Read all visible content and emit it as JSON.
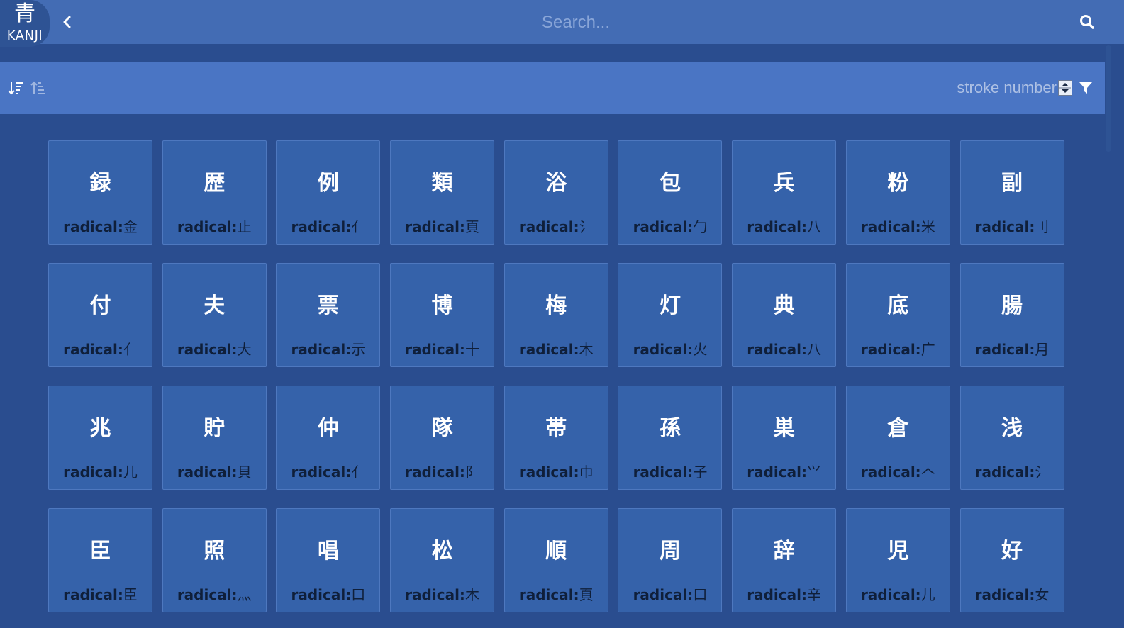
{
  "app": {
    "logo_kanji": "青",
    "logo_text": "KANJI",
    "back_icon": "chevron-left-icon",
    "search_placeholder": "Search...",
    "search_icon": "magnifier-icon"
  },
  "sort": {
    "desc_icon": "sort-descending-icon",
    "asc_icon": "sort-ascending-icon",
    "label": "stroke number",
    "stepper_icon": "up-down-stepper-icon",
    "filter_icon": "filter-icon"
  },
  "colors": {
    "topbar": "#436cb4",
    "sortbar": "#4a75c4",
    "background": "#2a4d8f",
    "card": "#3562aa"
  },
  "radical_label": "radical:",
  "cards": [
    {
      "kanji": "録",
      "radical": "金"
    },
    {
      "kanji": "歴",
      "radical": "止"
    },
    {
      "kanji": "例",
      "radical": "亻"
    },
    {
      "kanji": "類",
      "radical": "頁"
    },
    {
      "kanji": "浴",
      "radical": "氵"
    },
    {
      "kanji": "包",
      "radical": "勹"
    },
    {
      "kanji": "兵",
      "radical": "八"
    },
    {
      "kanji": "粉",
      "radical": "米"
    },
    {
      "kanji": "副",
      "radical": "刂"
    },
    {
      "kanji": "付",
      "radical": "亻"
    },
    {
      "kanji": "夫",
      "radical": "大"
    },
    {
      "kanji": "票",
      "radical": "示"
    },
    {
      "kanji": "博",
      "radical": "十"
    },
    {
      "kanji": "梅",
      "radical": "木"
    },
    {
      "kanji": "灯",
      "radical": "火"
    },
    {
      "kanji": "典",
      "radical": "八"
    },
    {
      "kanji": "底",
      "radical": "广"
    },
    {
      "kanji": "腸",
      "radical": "月"
    },
    {
      "kanji": "兆",
      "radical": "儿"
    },
    {
      "kanji": "貯",
      "radical": "貝"
    },
    {
      "kanji": "仲",
      "radical": "亻"
    },
    {
      "kanji": "隊",
      "radical": "阝"
    },
    {
      "kanji": "帯",
      "radical": "巾"
    },
    {
      "kanji": "孫",
      "radical": "子"
    },
    {
      "kanji": "巣",
      "radical": "⺍"
    },
    {
      "kanji": "倉",
      "radical": "𠆢"
    },
    {
      "kanji": "浅",
      "radical": "氵"
    },
    {
      "kanji": "臣",
      "radical": "臣"
    },
    {
      "kanji": "照",
      "radical": "灬"
    },
    {
      "kanji": "唱",
      "radical": "口"
    },
    {
      "kanji": "松",
      "radical": "木"
    },
    {
      "kanji": "順",
      "radical": "頁"
    },
    {
      "kanji": "周",
      "radical": "口"
    },
    {
      "kanji": "辞",
      "radical": "辛"
    },
    {
      "kanji": "児",
      "radical": "儿"
    },
    {
      "kanji": "好",
      "radical": "女"
    }
  ]
}
